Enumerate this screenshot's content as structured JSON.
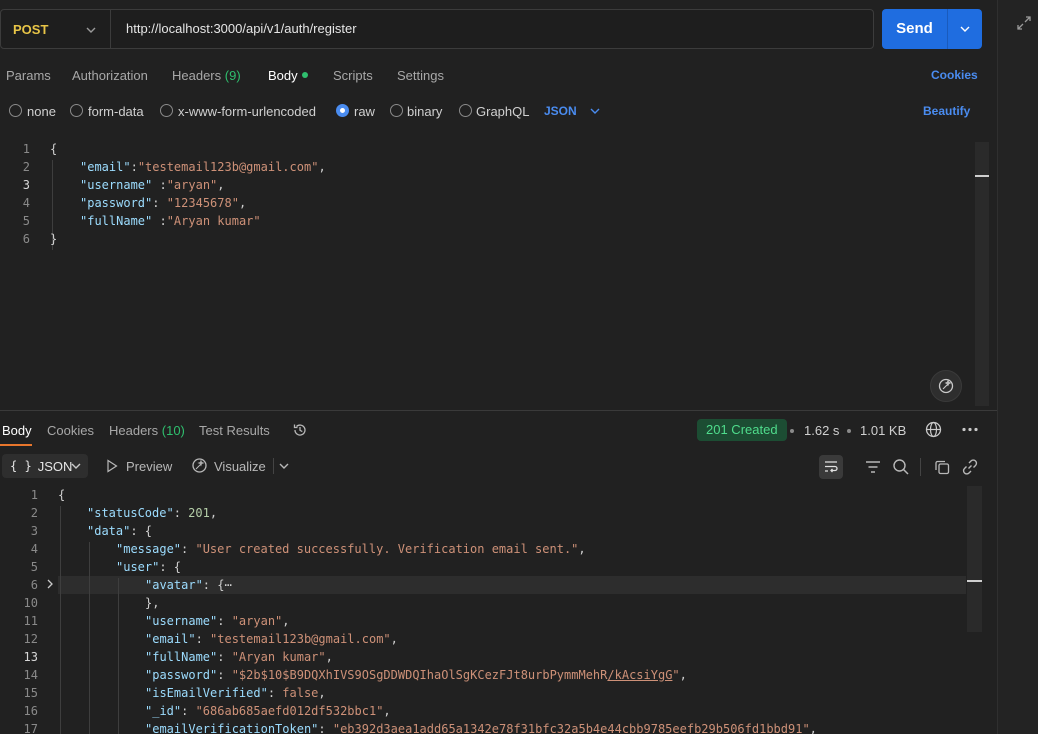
{
  "request": {
    "method": "POST",
    "url": "http://localhost:3000/api/v1/auth/register",
    "send_label": "Send",
    "tabs": {
      "params": "Params",
      "authorization": "Authorization",
      "headers": "Headers",
      "headers_count": "(9)",
      "body": "Body",
      "scripts": "Scripts",
      "settings": "Settings"
    },
    "cookies_label": "Cookies",
    "body_types": {
      "none": "none",
      "form_data": "form-data",
      "urlencoded": "x-www-form-urlencoded",
      "raw": "raw",
      "binary": "binary",
      "graphql": "GraphQL"
    },
    "selected_body_type": "raw",
    "raw_format": "JSON",
    "beautify_label": "Beautify",
    "body_lines": {
      "n1": "1",
      "n2": "2",
      "n3": "3",
      "n4": "4",
      "n5": "5",
      "n6": "6",
      "open": "{",
      "email_key": "\"email\"",
      "email_val": "\"testemail123b@gmail.com\"",
      "username_key": "\"username\"",
      "username_val": "\"aryan\"",
      "password_key": "\"password\"",
      "password_val": "\"12345678\"",
      "fullname_key": "\"fullName\"",
      "fullname_val": "\"Aryan kumar\"",
      "close": "}"
    }
  },
  "response": {
    "tabs": {
      "body": "Body",
      "cookies": "Cookies",
      "headers": "Headers",
      "headers_count": "(10)",
      "test_results": "Test Results"
    },
    "status": "201 Created",
    "time": "1.62 s",
    "size": "1.01 KB",
    "format": "JSON",
    "preview_label": "Preview",
    "visualize_label": "Visualize",
    "lines": {
      "n1": "1",
      "n2": "2",
      "n3": "3",
      "n4": "4",
      "n5": "5",
      "n6": "6",
      "n10": "10",
      "n11": "11",
      "n12": "12",
      "n13": "13",
      "n14": "14",
      "n15": "15",
      "n16": "16",
      "n17": "17",
      "open": "{",
      "status_key": "\"statusCode\"",
      "status_val": "201",
      "data_key": "\"data\"",
      "message_key": "\"message\"",
      "message_val": "\"User created successfully. Verification email sent.\"",
      "user_key": "\"user\"",
      "avatar_key": "\"avatar\"",
      "avatar_fold": "{⋯",
      "avatar_close": "},",
      "username_key": "\"username\"",
      "username_val": "\"aryan\"",
      "email_key": "\"email\"",
      "email_val": "\"testemail123b@gmail.com\"",
      "fullname_key": "\"fullName\"",
      "fullname_val": "\"Aryan kumar\"",
      "password_key": "\"password\"",
      "password_val_a": "\"$2b$10$B9DQXhIVS9OSgDDWDQIhaOlSgKCezFJt8urbPymmMehR",
      "password_val_b": "/kAcsiYgG",
      "password_val_c": "\"",
      "verified_key": "\"isEmailVerified\"",
      "verified_val": "false",
      "id_key": "\"_id\"",
      "id_val": "\"686ab685aefd012df532bbc1\"",
      "token_key": "\"emailVerificationToken\"",
      "token_val": "\"eb392d3aea1add65a1342e78f31bfc32a5b4e44cbb9785eefb29b506fd1bbd91\""
    }
  },
  "colors": {
    "accent": "#1f6de0",
    "method": "#e8c547",
    "status_ok": "#4fdc8c",
    "link": "#4a8cf0",
    "active_tab": "#e8762c"
  },
  "icons": [
    "expand-icon",
    "chevron-down-icon",
    "history-icon",
    "globe-icon",
    "more-icon",
    "wrap-lines-icon",
    "filter-icon",
    "search-icon",
    "copy-icon",
    "link-icon",
    "visualize-icon",
    "preview-icon",
    "magic-wand-icon"
  ]
}
